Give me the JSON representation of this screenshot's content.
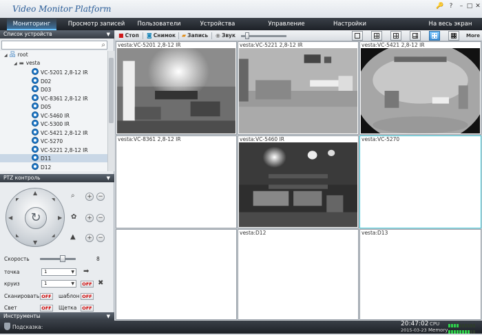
{
  "app": {
    "title": "Video Monitor Platform"
  },
  "window_controls": [
    "🔑",
    "?",
    "–",
    "□",
    "✕"
  ],
  "menu": [
    {
      "label": "Мониторинг",
      "active": true
    },
    {
      "label": "Просмотр записей"
    },
    {
      "label": "Пользователи"
    },
    {
      "label": "Устройства"
    },
    {
      "label": "Управление"
    },
    {
      "label": "Настройки"
    },
    {
      "label": "На весь экран"
    }
  ],
  "device_list": {
    "header": "Список устройств",
    "search_placeholder": "",
    "root_label": "root",
    "group_label": "vesta",
    "items": [
      "VC-5201 2,8-12 IR",
      "D02",
      "D03",
      "VC-8361 2,8-12 IR",
      "D05",
      "VC-5460 IR",
      "VC-5300 IR",
      "VC-5421 2,8-12 IR",
      "VC-5270",
      "VC-5221 2,8-12 IR",
      "D11",
      "D12"
    ],
    "selected_index": 10
  },
  "ptz": {
    "header": "PTZ контроль",
    "speed_label": "Скорость",
    "speed_value": "8",
    "speed_level": 0.65,
    "point_label": "точка",
    "point_value": "1",
    "cruise_label": "круиз",
    "cruise_value": "1",
    "off": "OFF",
    "scan_label": "Сканировать",
    "pattern_label": "шаблон",
    "light_label": "Свет",
    "brush_label": "Щетка",
    "plus": "+",
    "minus": "−"
  },
  "tools_header": "Инструменты",
  "toolbar": {
    "stop": "Стоп",
    "snapshot": "Снимок",
    "record": "Запись",
    "sound": "Звук",
    "more": "More",
    "volume_level": 0.1
  },
  "cells": [
    {
      "label": "vesta:VC-5201 2,8-12 IR",
      "feed": "showroom-bright"
    },
    {
      "label": "vesta:VC-5221 2,8-12 IR",
      "feed": "office"
    },
    {
      "label": "vesta:VC-5421 2,8-12 IR",
      "feed": "fisheye"
    },
    {
      "label": "vesta:VC-8361 2,8-12 IR",
      "feed": ""
    },
    {
      "label": "vesta:VC-5460 IR",
      "feed": "dark-showroom"
    },
    {
      "label": "vesta:VC-5270",
      "feed": "",
      "selected": true
    },
    {
      "label": "",
      "feed": ""
    },
    {
      "label": "vesta:D12",
      "feed": ""
    },
    {
      "label": "vesta:D13",
      "feed": ""
    }
  ],
  "status": {
    "hint_label": "Подсказка:",
    "time": "20:47:02",
    "date": "2015-03-23",
    "cpu_label": "CPU",
    "memory_label": "Memory",
    "cpu_level": 0.35,
    "memory_level": 0.75
  }
}
